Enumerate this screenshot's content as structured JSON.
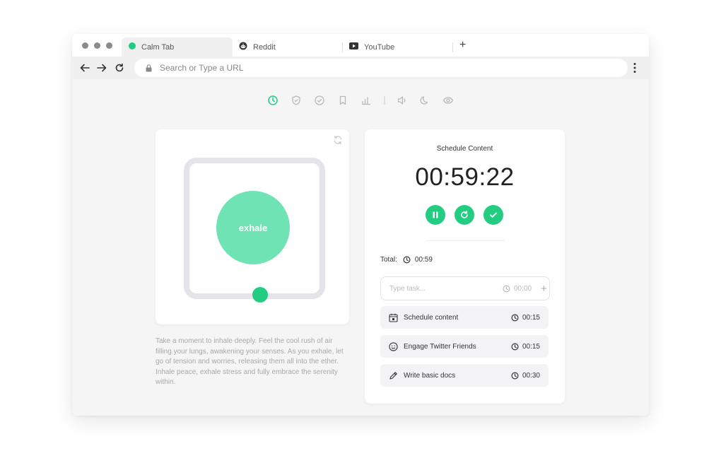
{
  "browser": {
    "tabs": [
      {
        "label": "Calm Tab",
        "icon": "green-dot-icon"
      },
      {
        "label": "Reddit",
        "icon": "reddit-icon"
      },
      {
        "label": "YouTube",
        "icon": "youtube-icon"
      }
    ],
    "new_tab": "+",
    "address_placeholder": "Search or Type a URL"
  },
  "toolbar_icons": [
    "clock-icon",
    "shield-icon",
    "check-circle-icon",
    "bookmark-icon",
    "bar-chart-icon",
    "speaker-icon",
    "moon-icon",
    "eye-icon"
  ],
  "breathing": {
    "label": "exhale",
    "description": "Take a moment to inhale deeply. Feel the cool rush of air filling your lungs, awakening your senses. As you exhale, let go of tension and worries, releasing them all into the ether. Inhale peace, exhale stress and fully embrace the serenity within."
  },
  "schedule": {
    "title": "Schedule Content",
    "timer": "00:59:22",
    "total_label": "Total:",
    "total_value": "00:59",
    "input": {
      "placeholder": "Type task...",
      "time": "00:00",
      "add": "+"
    },
    "tasks": [
      {
        "name": "Schedule content",
        "time": "00:15",
        "icon": "calendar-icon"
      },
      {
        "name": "Engage Twitter Friends",
        "time": "00:15",
        "icon": "smiley-icon"
      },
      {
        "name": "Write basic docs",
        "time": "00:30",
        "icon": "pencil-icon"
      }
    ]
  },
  "colors": {
    "accent": "#22cd82",
    "accent_light": "#6fe3b4",
    "window_bg": "#f5f5f5"
  }
}
